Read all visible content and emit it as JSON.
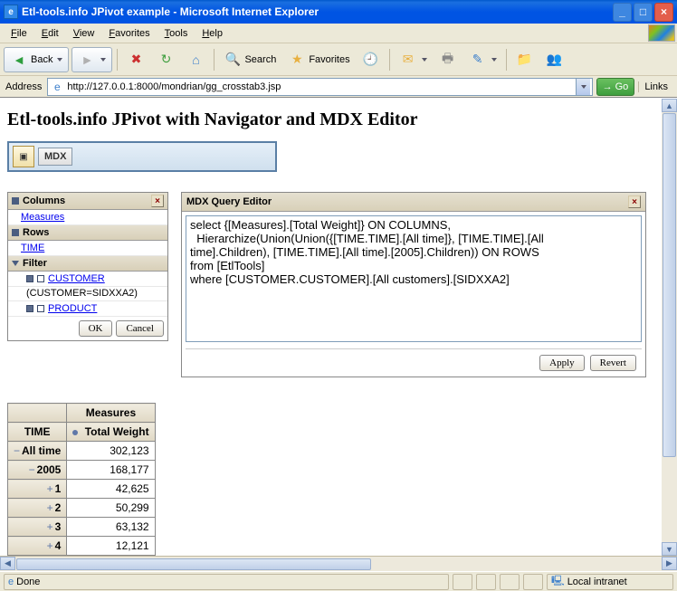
{
  "window": {
    "title": "Etl-tools.info JPivot example - Microsoft Internet Explorer"
  },
  "menu": {
    "items": [
      "File",
      "Edit",
      "View",
      "Favorites",
      "Tools",
      "Help"
    ]
  },
  "toolbar": {
    "back": "Back",
    "search": "Search",
    "favorites": "Favorites"
  },
  "address": {
    "label": "Address",
    "url": "http://127.0.0.1:8000/mondrian/gg_crosstab3.jsp",
    "go": "Go",
    "links": "Links"
  },
  "page": {
    "title": "Etl-tools.info JPivot with Navigator and MDX Editor",
    "mdx_badge": "MDX"
  },
  "navigator": {
    "columns": {
      "header": "Columns",
      "item": "Measures"
    },
    "rows": {
      "header": "Rows",
      "item": "TIME"
    },
    "filter": {
      "header": "Filter",
      "customer_link": "CUSTOMER",
      "customer_detail": "(CUSTOMER=SIDXXA2)",
      "product_link": "PRODUCT"
    },
    "ok": "OK",
    "cancel": "Cancel"
  },
  "mdx_editor": {
    "title": "MDX Query Editor",
    "query": "select {[Measures].[Total Weight]} ON COLUMNS,\n  Hierarchize(Union(Union({[TIME.TIME].[All time]}, [TIME.TIME].[All time].Children), [TIME.TIME].[All time].[2005].Children)) ON ROWS\nfrom [EtlTools]\nwhere [CUSTOMER.CUSTOMER].[All customers].[SIDXXA2]",
    "apply": "Apply",
    "revert": "Revert"
  },
  "pivot": {
    "measures_header": "Measures",
    "time_header": "TIME",
    "total_weight_header": "Total Weight",
    "rows": [
      {
        "label": "All time",
        "expand": "−",
        "indent": 0,
        "value": "302,123"
      },
      {
        "label": "2005",
        "expand": "−",
        "indent": 1,
        "value": "168,177"
      },
      {
        "label": "1",
        "expand": "+",
        "indent": 2,
        "value": "42,625"
      },
      {
        "label": "2",
        "expand": "+",
        "indent": 2,
        "value": "50,299"
      },
      {
        "label": "3",
        "expand": "+",
        "indent": 2,
        "value": "63,132"
      },
      {
        "label": "4",
        "expand": "+",
        "indent": 2,
        "value": "12,121"
      }
    ]
  },
  "status": {
    "done": "Done",
    "zone": "Local intranet"
  }
}
